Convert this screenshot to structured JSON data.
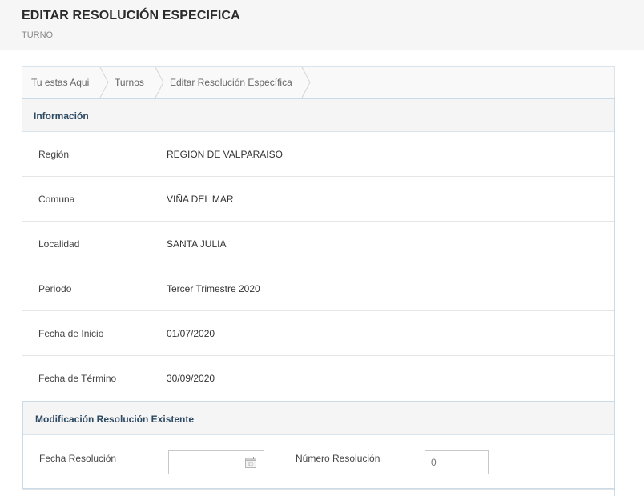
{
  "header": {
    "title": "EDITAR RESOLUCIÓN ESPECIFICA",
    "subtitle": "TURNO"
  },
  "breadcrumb": {
    "items": [
      {
        "label": "Tu estas Aqui"
      },
      {
        "label": "Turnos"
      },
      {
        "label": "Editar Resolución Específica"
      }
    ]
  },
  "info_panel": {
    "title": "Información",
    "rows": [
      {
        "label": "Región",
        "value": "REGION DE VALPARAISO"
      },
      {
        "label": "Comuna",
        "value": "VIÑA DEL MAR"
      },
      {
        "label": "Localidad",
        "value": "SANTA JULIA"
      },
      {
        "label": "Periodo",
        "value": "Tercer Trimestre 2020"
      },
      {
        "label": "Fecha de Inicio",
        "value": "01/07/2020"
      },
      {
        "label": "Fecha de Término",
        "value": "30/09/2020"
      }
    ]
  },
  "modification_panel": {
    "title": "Modificación Resolución Existente",
    "fecha_label": "Fecha Resolución",
    "fecha_value": "",
    "numero_label": "Número Resolución",
    "numero_placeholder": "0",
    "calendar_icon": "calendar-icon"
  }
}
